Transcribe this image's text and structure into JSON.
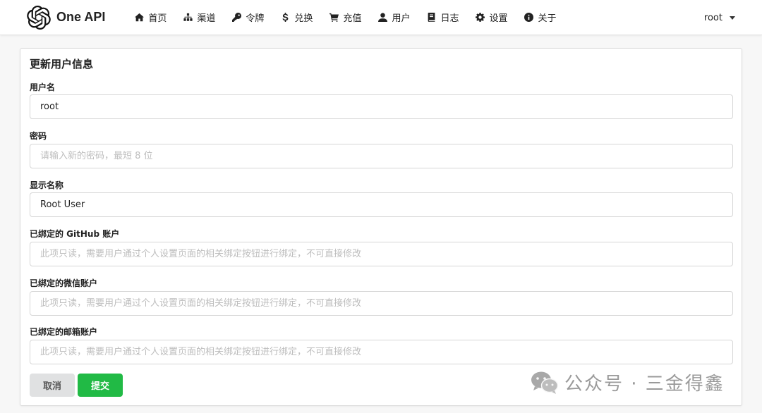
{
  "app": {
    "name": "One API",
    "logo_icon": "openai-logo-icon"
  },
  "nav": {
    "items": [
      {
        "label": "首页",
        "icon": "home-icon"
      },
      {
        "label": "渠道",
        "icon": "sitemap-icon"
      },
      {
        "label": "令牌",
        "icon": "key-icon"
      },
      {
        "label": "兑换",
        "icon": "dollar-icon"
      },
      {
        "label": "充值",
        "icon": "cart-icon"
      },
      {
        "label": "用户",
        "icon": "user-icon"
      },
      {
        "label": "日志",
        "icon": "book-icon"
      },
      {
        "label": "设置",
        "icon": "gear-icon"
      },
      {
        "label": "关于",
        "icon": "info-circle-icon"
      }
    ],
    "user_menu": {
      "label": "root",
      "icon": "caret-down-icon"
    }
  },
  "form": {
    "title": "更新用户信息",
    "fields": [
      {
        "label": "用户名",
        "value": "root",
        "placeholder": ""
      },
      {
        "label": "密码",
        "value": "",
        "placeholder": "请输入新的密码，最短 8 位"
      },
      {
        "label": "显示名称",
        "value": "Root User",
        "placeholder": ""
      },
      {
        "label": "已绑定的 GitHub 账户",
        "value": "",
        "placeholder": "此项只读，需要用户通过个人设置页面的相关绑定按钮进行绑定，不可直接修改"
      },
      {
        "label": "已绑定的微信账户",
        "value": "",
        "placeholder": "此项只读，需要用户通过个人设置页面的相关绑定按钮进行绑定，不可直接修改"
      },
      {
        "label": "已绑定的邮箱账户",
        "value": "",
        "placeholder": "此项只读，需要用户通过个人设置页面的相关绑定按钮进行绑定，不可直接修改"
      }
    ],
    "buttons": {
      "cancel": "取消",
      "submit": "提交"
    }
  },
  "watermark": {
    "text": "公众号 · 三金得鑫",
    "icon": "wechat-icon"
  },
  "colors": {
    "submit_button": "#21ba45",
    "cancel_button": "#e0e1e2",
    "page_background": "#f7f7f7"
  }
}
